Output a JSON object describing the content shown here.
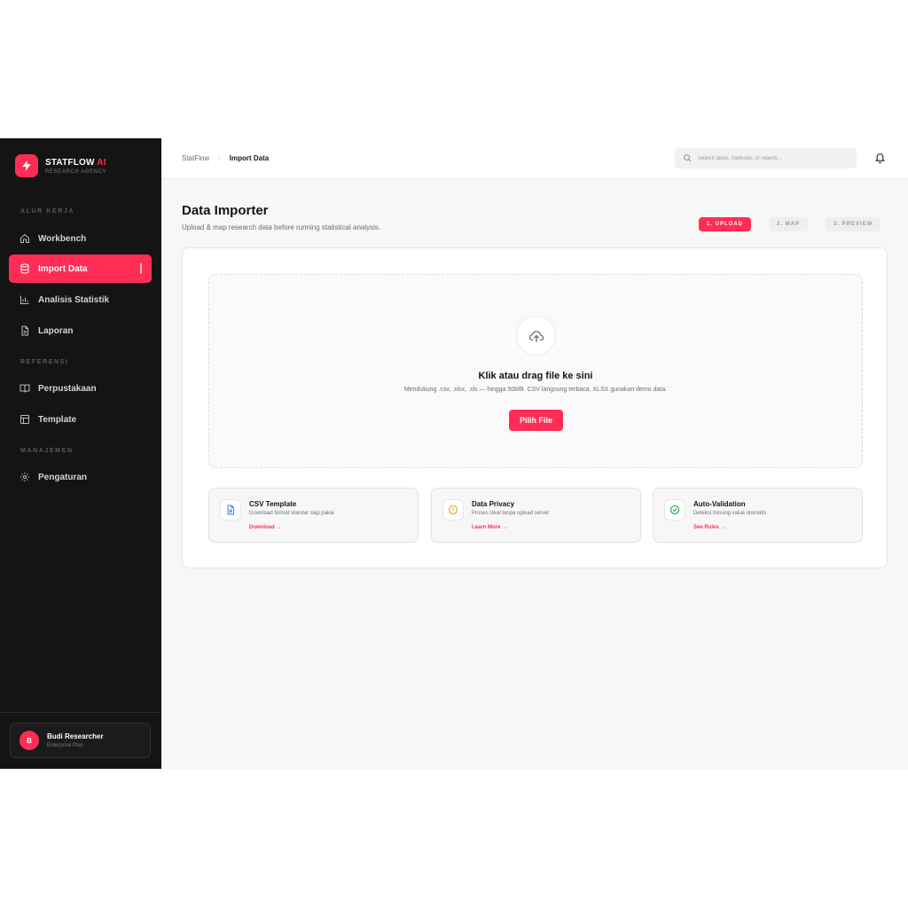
{
  "brand": {
    "name": "STATFLOW",
    "name_accent": "AI",
    "subtitle": "RESEARCH AGENCY"
  },
  "sidebar": {
    "sections": [
      {
        "label": "ALUR KERJA"
      },
      {
        "label": "REFERENSI"
      },
      {
        "label": "MANAJEMEN"
      }
    ],
    "items": [
      {
        "label": "Workbench",
        "icon": "home-icon",
        "active": false
      },
      {
        "label": "Import Data",
        "icon": "database-icon",
        "active": true
      },
      {
        "label": "Analisis Statistik",
        "icon": "bar-chart-icon",
        "active": false
      },
      {
        "label": "Laporan",
        "icon": "document-icon",
        "active": false
      },
      {
        "label": "Perpustakaan",
        "icon": "book-icon",
        "active": false
      },
      {
        "label": "Template",
        "icon": "layout-icon",
        "active": false
      },
      {
        "label": "Pengaturan",
        "icon": "gear-icon",
        "active": false
      }
    ]
  },
  "user": {
    "initial": "B",
    "name": "Budi Researcher",
    "plan": "Enterprise Plan"
  },
  "header": {
    "breadcrumb": {
      "root": "StatFlow",
      "separator": "›",
      "current": "Import Data"
    },
    "search_placeholder": "Search tasks, methods, or reports...",
    "bell_icon": "bell-icon"
  },
  "page": {
    "title": "Data Importer",
    "subtitle": "Upload & map research data before running statistical analysis."
  },
  "steps": [
    {
      "label": "1. UPLOAD",
      "active": true
    },
    {
      "label": "2. MAP",
      "active": false
    },
    {
      "label": "3. PREVIEW",
      "active": false
    }
  ],
  "dropzone": {
    "icon": "cloud-upload-icon",
    "title": "Klik atau drag file ke sini",
    "description": "Mendukung .csv, .xlsx, .xls — hingga 50MB. CSV langsung terbaca, XLSX gunakan demo data.",
    "button_label": "Pilih File"
  },
  "info_cards": [
    {
      "icon": "file-icon",
      "title": "CSV Template",
      "description": "Download format standar siap pakai",
      "link": "Download →"
    },
    {
      "icon": "alert-circle-icon",
      "title": "Data Privacy",
      "description": "Proses lokal tanpa upload server",
      "link": "Learn More →"
    },
    {
      "icon": "check-circle-icon",
      "title": "Auto-Validation",
      "description": "Deteksi missing value otomatis",
      "link": "See Rules →"
    }
  ],
  "colors": {
    "accent": "#ff2d55",
    "sidebar_bg": "#141414",
    "main_bg": "#f7f7f7"
  }
}
